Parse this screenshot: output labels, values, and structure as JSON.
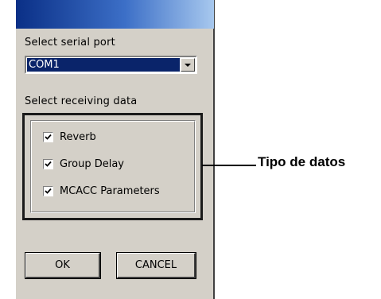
{
  "dialog": {
    "serial_port_label": "Select serial port",
    "serial_port_value": "COM1",
    "receiving_label": "Select receiving data",
    "checkboxes": [
      {
        "label": "Reverb",
        "checked": true
      },
      {
        "label": "Group Delay",
        "checked": true
      },
      {
        "label": "MCACC Parameters",
        "checked": true
      }
    ],
    "ok_label": "OK",
    "cancel_label": "CANCEL"
  },
  "callout": {
    "text": "Tipo de datos"
  },
  "colors": {
    "dialog_face": "#d4d0c8",
    "title_start": "#0a2f86",
    "title_end": "#a7c8ee",
    "selection": "#0a246a"
  }
}
